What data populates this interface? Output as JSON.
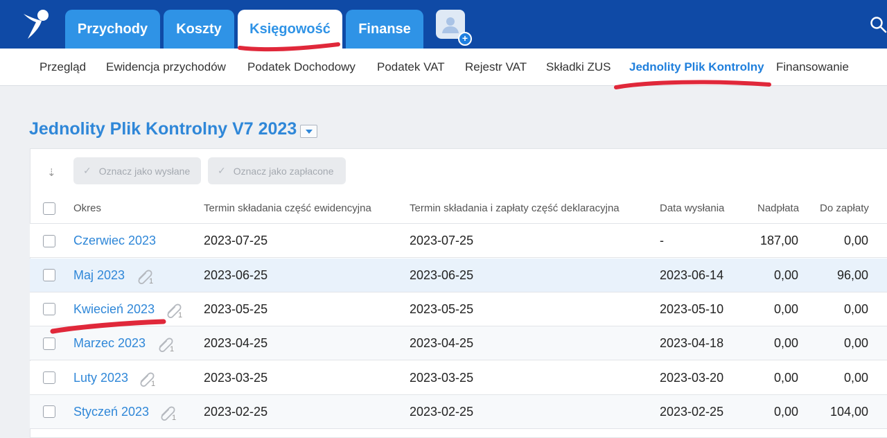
{
  "topbar": {
    "tabs": [
      {
        "label": "Przychody"
      },
      {
        "label": "Koszty"
      },
      {
        "label": "Księgowość"
      },
      {
        "label": "Finanse"
      }
    ],
    "avatar_plus": "+"
  },
  "subnav": {
    "items": [
      {
        "label": "Przegląd"
      },
      {
        "label": "Ewidencja przychodów"
      },
      {
        "label": "Podatek Dochodowy"
      },
      {
        "label": "Podatek VAT"
      },
      {
        "label": "Rejestr VAT"
      },
      {
        "label": "Składki ZUS"
      },
      {
        "label": "Jednolity Plik Kontrolny"
      },
      {
        "label": "Finansowanie"
      }
    ]
  },
  "page": {
    "title": "Jednolity Plik Kontrolny V7 2023"
  },
  "toolbar": {
    "mark_sent": "Oznacz jako wysłane",
    "mark_paid": "Oznacz jako zapłacone"
  },
  "table": {
    "headers": {
      "period": "Okres",
      "deadline_records": "Termin składania część ewidencyjna",
      "deadline_declaration": "Termin składania i zapłaty część deklaracyjna",
      "sent_date": "Data wysłania",
      "overpayment": "Nadpłata",
      "to_pay": "Do zapłaty"
    },
    "rows": [
      {
        "period": "Czerwiec 2023",
        "attachments": "",
        "deadline_records": "2023-07-25",
        "deadline_declaration": "2023-07-25",
        "sent_date": "-",
        "overpayment": "187,00",
        "to_pay": "0,00"
      },
      {
        "period": "Maj 2023",
        "attachments": "1",
        "deadline_records": "2023-06-25",
        "deadline_declaration": "2023-06-25",
        "sent_date": "2023-06-14",
        "overpayment": "0,00",
        "to_pay": "96,00"
      },
      {
        "period": "Kwiecień 2023",
        "attachments": "1",
        "deadline_records": "2023-05-25",
        "deadline_declaration": "2023-05-25",
        "sent_date": "2023-05-10",
        "overpayment": "0,00",
        "to_pay": "0,00"
      },
      {
        "period": "Marzec 2023",
        "attachments": "1",
        "deadline_records": "2023-04-25",
        "deadline_declaration": "2023-04-25",
        "sent_date": "2023-04-18",
        "overpayment": "0,00",
        "to_pay": "0,00"
      },
      {
        "period": "Luty 2023",
        "attachments": "1",
        "deadline_records": "2023-03-25",
        "deadline_declaration": "2023-03-25",
        "sent_date": "2023-03-20",
        "overpayment": "0,00",
        "to_pay": "0,00"
      },
      {
        "period": "Styczeń 2023",
        "attachments": "1",
        "deadline_records": "2023-02-25",
        "deadline_declaration": "2023-02-25",
        "sent_date": "2023-02-25",
        "overpayment": "0,00",
        "to_pay": "104,00"
      }
    ]
  },
  "colors": {
    "topbar": "#0f4aa6",
    "tab": "#2f93e6",
    "accent": "#2f87d8",
    "annotation": "#e0283a"
  }
}
